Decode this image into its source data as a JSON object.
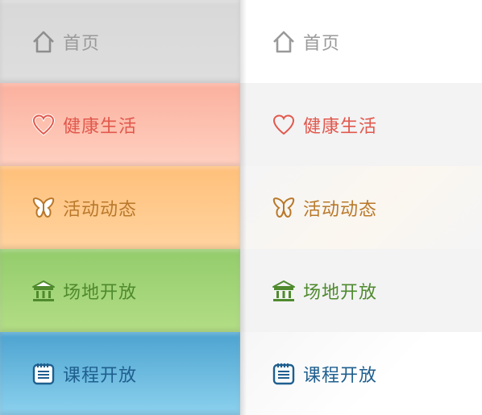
{
  "menu": {
    "items": [
      {
        "key": "home",
        "label": "首页",
        "icon": "home-icon",
        "color": "#9a9a9a"
      },
      {
        "key": "health",
        "label": "健康生活",
        "icon": "heart-icon",
        "color": "#e2584c"
      },
      {
        "key": "events",
        "label": "活动动态",
        "icon": "butterfly-icon",
        "color": "#b9782a"
      },
      {
        "key": "venue",
        "label": "场地开放",
        "icon": "institution-icon",
        "color": "#4f8a2e"
      },
      {
        "key": "course",
        "label": "课程开放",
        "icon": "notebook-icon",
        "color": "#1f5f8f"
      }
    ]
  }
}
